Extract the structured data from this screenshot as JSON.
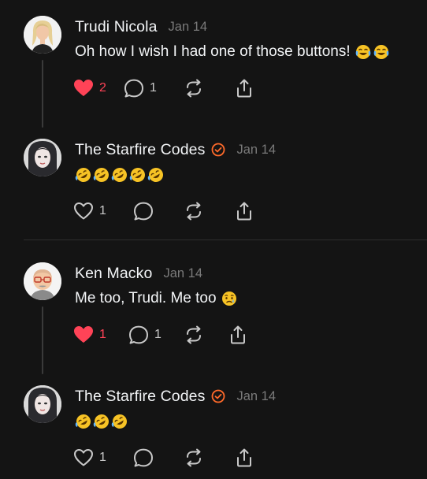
{
  "posts": [
    {
      "author": "Trudi Nicola",
      "date": "Jan 14",
      "verified": false,
      "text": "Oh how I wish I had one of those buttons! ",
      "emojis": [
        "😂",
        "😂"
      ],
      "liked": true,
      "like_count": "2",
      "reply_count": "1"
    },
    {
      "author": "The Starfire Codes",
      "date": "Jan 14",
      "verified": true,
      "text": "",
      "emojis": [
        "🤣",
        "🤣",
        "🤣",
        "🤣",
        "🤣"
      ],
      "liked": false,
      "like_count": "1",
      "reply_count": ""
    },
    {
      "author": "Ken Macko",
      "date": "Jan 14",
      "verified": false,
      "text": "Me too, Trudi. Me too ",
      "emojis": [
        "😢"
      ],
      "liked": true,
      "like_count": "1",
      "reply_count": "1"
    },
    {
      "author": "The Starfire Codes",
      "date": "Jan 14",
      "verified": true,
      "text": "",
      "emojis": [
        "🤣",
        "🤣",
        "🤣"
      ],
      "liked": false,
      "like_count": "1",
      "reply_count": ""
    }
  ],
  "colors": {
    "background": "#141414",
    "like_active": "#ff4357",
    "verified_badge": "#ff6a2a",
    "emoji_yellow": "#f7c325",
    "icon": "#c9c9c9",
    "muted_text": "#7a7a7a"
  },
  "icons": {
    "like": "heart-icon",
    "reply": "comment-icon",
    "repost": "repost-icon",
    "share": "share-icon",
    "verified": "verified-badge-icon"
  }
}
